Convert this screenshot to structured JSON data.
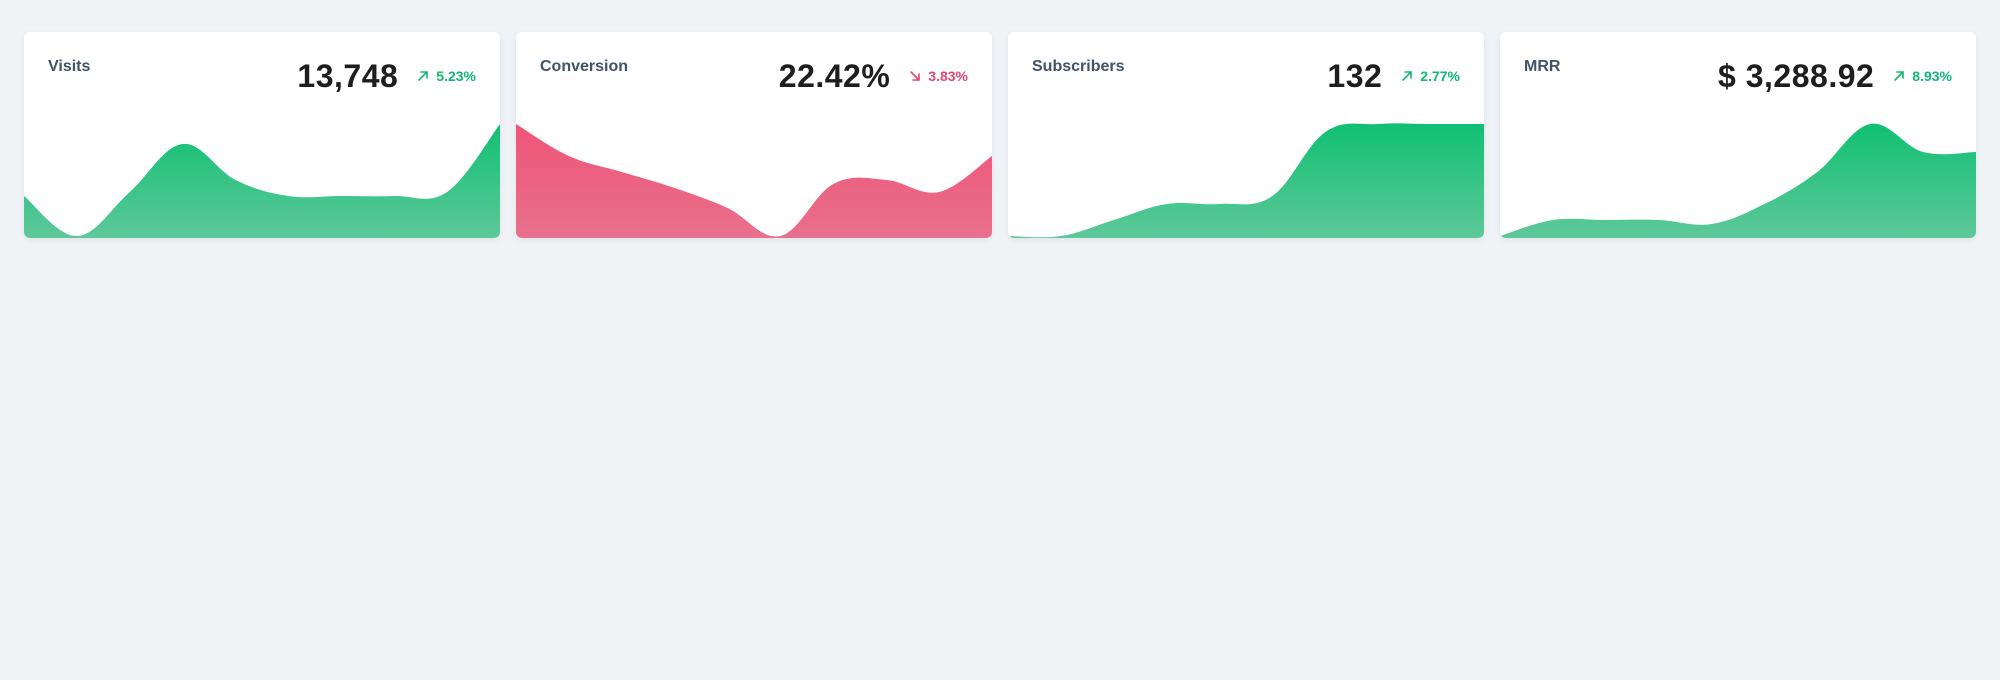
{
  "cards": [
    {
      "label": "Visits",
      "value": "13,748",
      "delta": "5.23%",
      "trend": "up",
      "trend_icon": "arrow-up-right-icon",
      "color": "#10c073",
      "color_light": "#5ec89a",
      "sparkline": [
        2.8,
        1.8,
        2.9,
        4.1,
        3.2,
        2.8,
        2.8,
        2.8,
        2.9,
        4.6
      ]
    },
    {
      "label": "Conversion",
      "value": "22.42%",
      "delta": "3.83%",
      "trend": "down",
      "trend_icon": "arrow-down-right-icon",
      "color": "#ef5478",
      "color_light": "#e8708c",
      "sparkline": [
        4.6,
        3.8,
        3.4,
        3.0,
        2.5,
        1.8,
        3.1,
        3.2,
        2.9,
        3.8
      ]
    },
    {
      "label": "Subscribers",
      "value": "132",
      "delta": "2.77%",
      "trend": "up",
      "trend_icon": "arrow-up-right-icon",
      "color": "#10c073",
      "color_light": "#5ec89a",
      "sparkline": [
        1.8,
        1.8,
        2.2,
        2.6,
        2.6,
        2.8,
        4.4,
        4.6,
        4.6,
        4.6
      ]
    },
    {
      "label": "MRR",
      "value": "$ 3,288.92",
      "delta": "8.93%",
      "trend": "up",
      "trend_icon": "arrow-up-right-icon",
      "color": "#10c073",
      "color_light": "#5ec89a",
      "sparkline": [
        1.8,
        2.2,
        2.2,
        2.2,
        2.1,
        2.6,
        3.4,
        4.6,
        3.9,
        3.9
      ]
    }
  ]
}
